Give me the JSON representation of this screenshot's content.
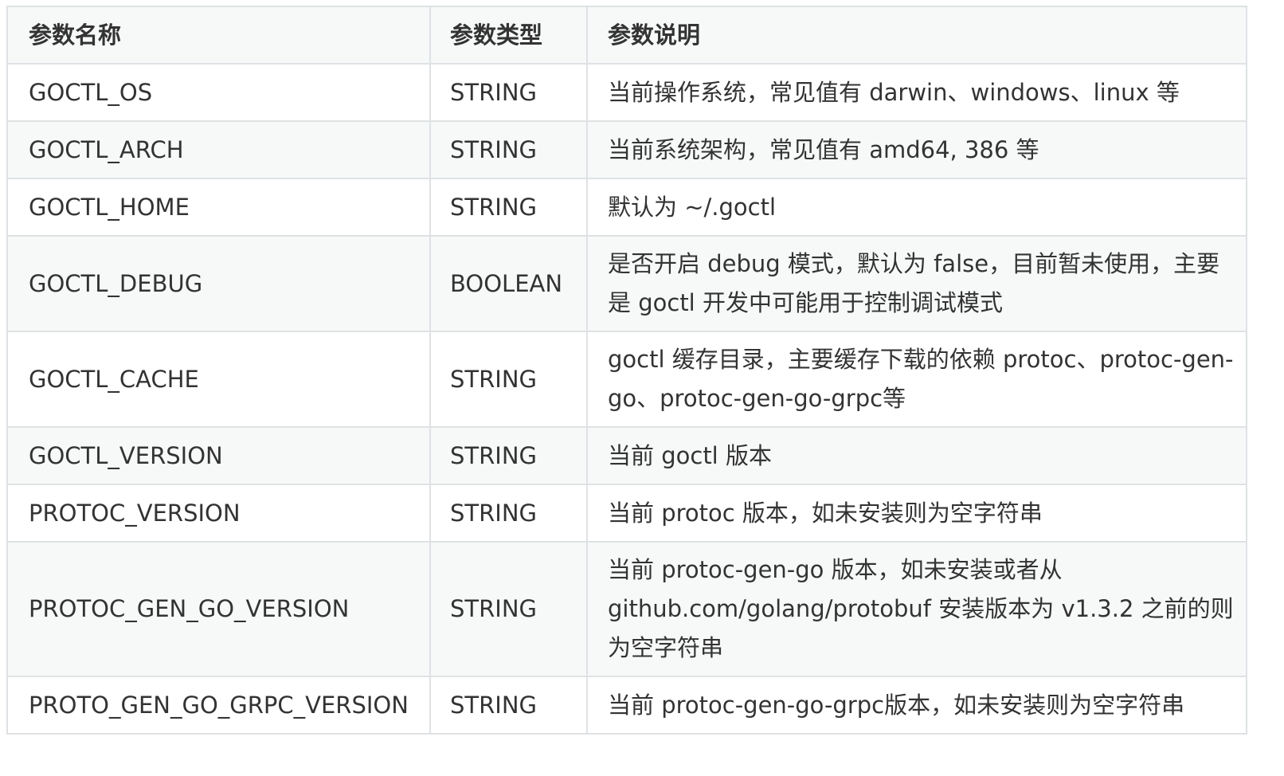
{
  "table": {
    "headers": [
      "参数名称",
      "参数类型",
      "参数说明"
    ],
    "rows": [
      {
        "name": "GOCTL_OS",
        "type": "STRING",
        "desc": "当前操作系统，常见值有 darwin、windows、linux 等"
      },
      {
        "name": "GOCTL_ARCH",
        "type": "STRING",
        "desc": "当前系统架构，常见值有 amd64, 386 等"
      },
      {
        "name": "GOCTL_HOME",
        "type": "STRING",
        "desc": "默认为 ~/.goctl"
      },
      {
        "name": "GOCTL_DEBUG",
        "type": "BOOLEAN",
        "desc": "是否开启 debug 模式，默认为 false，目前暂未使用，主要是 goctl 开发中可能用于控制调试模式"
      },
      {
        "name": "GOCTL_CACHE",
        "type": "STRING",
        "desc": "goctl 缓存目录，主要缓存下载的依赖 protoc、protoc-gen-go、protoc-gen-go-grpc等"
      },
      {
        "name": "GOCTL_VERSION",
        "type": "STRING",
        "desc": "当前 goctl 版本"
      },
      {
        "name": "PROTOC_VERSION",
        "type": "STRING",
        "desc": "当前 protoc 版本，如未安装则为空字符串"
      },
      {
        "name": "PROTOC_GEN_GO_VERSION",
        "type": "STRING",
        "desc": "当前 protoc-gen-go 版本，如未安装或者从 github.com/golang/protobuf 安装版本为 v1.3.2 之前的则为空字符串"
      },
      {
        "name": "PROTO_GEN_GO_GRPC_VERSION",
        "type": "STRING",
        "desc": "当前 protoc-gen-go-grpc版本，如未安装则为空字符串"
      }
    ]
  }
}
